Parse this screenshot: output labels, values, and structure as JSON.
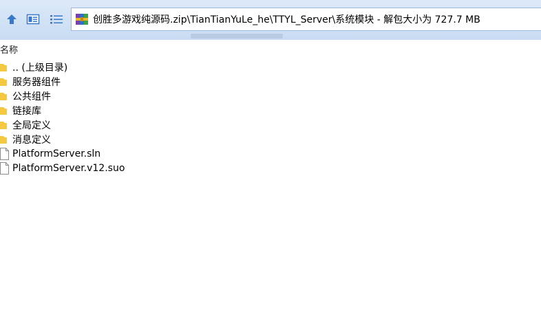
{
  "toolbar": {
    "up_icon": "up-arrow-icon",
    "view_icon": "window-view-icon",
    "list_icon": "list-view-icon"
  },
  "address": {
    "icon": "winrar-archive-icon",
    "path": "创胜多游戏纯源码.zip\\TianTianYuLe_he\\TTYL_Server\\系统模块 - 解包大小为 727.7 MB"
  },
  "list": {
    "column_header": "名称",
    "items": [
      {
        "name": ".. (上级目录)",
        "type": "folder"
      },
      {
        "name": "服务器组件",
        "type": "folder"
      },
      {
        "name": "公共组件",
        "type": "folder"
      },
      {
        "name": "链接库",
        "type": "folder"
      },
      {
        "name": "全局定义",
        "type": "folder"
      },
      {
        "name": "消息定义",
        "type": "folder"
      },
      {
        "name": "PlatformServer.sln",
        "type": "file"
      },
      {
        "name": "PlatformServer.v12.suo",
        "type": "file"
      }
    ]
  },
  "colors": {
    "toolbar_bg": "#cfe0f5",
    "folder_yellow": "#f5c842",
    "accent_blue": "#3a78c9"
  }
}
